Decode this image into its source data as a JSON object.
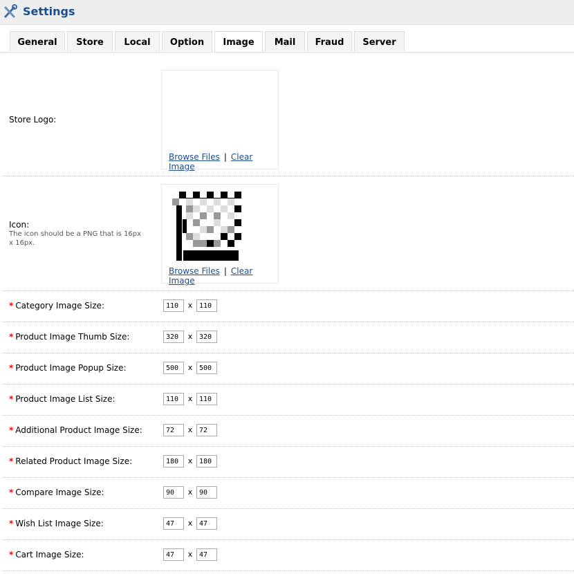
{
  "header": {
    "title": "Settings",
    "icon": "tools-icon"
  },
  "tabs": [
    "General",
    "Store",
    "Local",
    "Option",
    "Image",
    "Mail",
    "Fraud",
    "Server"
  ],
  "active_tab": "Image",
  "logo": {
    "label": "Store Logo:",
    "browse": "Browse Files",
    "clear": "Clear Image",
    "separator": "|"
  },
  "icon": {
    "label": "Icon:",
    "help": "The icon should be a PNG that is 16px x 16px.",
    "browse": "Browse Files",
    "clear": "Clear Image",
    "separator": "|"
  },
  "sizes": [
    {
      "label": "Category Image Size:",
      "w": "110",
      "h": "110"
    },
    {
      "label": "Product Image Thumb Size:",
      "w": "320",
      "h": "320"
    },
    {
      "label": "Product Image Popup Size:",
      "w": "500",
      "h": "500"
    },
    {
      "label": "Product Image List Size:",
      "w": "110",
      "h": "110"
    },
    {
      "label": "Additional Product Image Size:",
      "w": "72",
      "h": "72"
    },
    {
      "label": "Related Product Image Size:",
      "w": "180",
      "h": "180"
    },
    {
      "label": "Compare Image Size:",
      "w": "90",
      "h": "90"
    },
    {
      "label": "Wish List Image Size:",
      "w": "47",
      "h": "47"
    },
    {
      "label": "Cart Image Size:",
      "w": "47",
      "h": "47"
    }
  ],
  "required_mark": "*",
  "times": "x"
}
